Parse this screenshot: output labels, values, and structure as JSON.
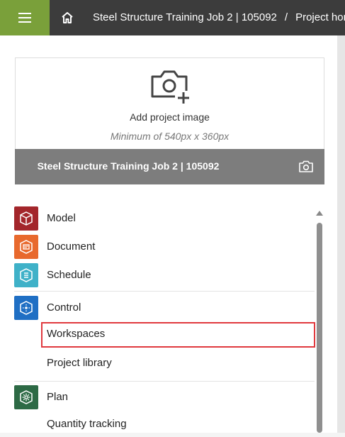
{
  "breadcrumb": {
    "project": "Steel Structure Training Job 2 | 105092",
    "separator": "/",
    "current": "Project home"
  },
  "image_card": {
    "add_label": "Add project image",
    "min_size": "Minimum of 540px x 360px",
    "project_name": "Steel Structure Training Job 2 | 105092"
  },
  "modules": [
    {
      "label": "Model",
      "color": "#a3262b",
      "icon": "cube-icon"
    },
    {
      "label": "Document",
      "color": "#e8692d",
      "icon": "document-icon"
    },
    {
      "label": "Schedule",
      "color": "#3fb1c8",
      "icon": "schedule-icon"
    },
    {
      "label": "Control",
      "color": "#1f6fc4",
      "icon": "control-icon",
      "children": [
        "Workspaces",
        "Project library"
      ]
    },
    {
      "label": "Plan",
      "color": "#2d6a45",
      "icon": "plan-icon",
      "children": [
        "Quantity tracking"
      ]
    }
  ],
  "colors": {
    "topbar": "#3c3c3c",
    "menu_button": "#7aa03a",
    "highlight": "#e0393e"
  }
}
